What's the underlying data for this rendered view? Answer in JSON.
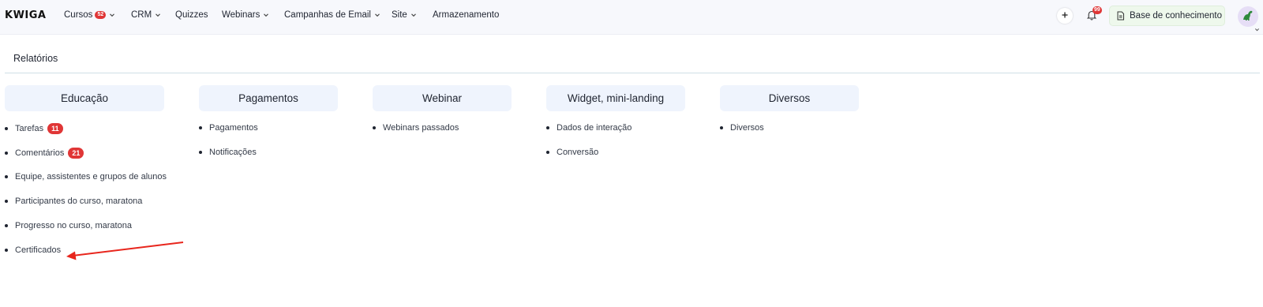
{
  "app": {
    "logo": "KWIGA"
  },
  "nav": {
    "items": [
      {
        "label": "Cursos",
        "badge": "52",
        "dropdown": true
      },
      {
        "label": "CRM",
        "dropdown": true
      },
      {
        "label": "Quizzes",
        "dropdown": false
      },
      {
        "label": "Webinars",
        "dropdown": true
      },
      {
        "label": "Campanhas de Email",
        "dropdown": true
      },
      {
        "label": "Site",
        "dropdown": true
      },
      {
        "label": "Armazenamento",
        "dropdown": false
      }
    ]
  },
  "header_actions": {
    "notifications_badge": "99",
    "knowledge_base_label": "Base de conhecimento"
  },
  "page": {
    "title": "Relatórios"
  },
  "columns": [
    {
      "header": "Educação",
      "items": [
        {
          "label": "Tarefas",
          "badge": "11"
        },
        {
          "label": "Comentários",
          "badge": "21"
        },
        {
          "label": "Equipe, assistentes e grupos de alunos"
        },
        {
          "label": "Participantes do curso, maratona"
        },
        {
          "label": "Progresso no curso, maratona"
        },
        {
          "label": "Certificados"
        }
      ]
    },
    {
      "header": "Pagamentos",
      "items": [
        {
          "label": "Pagamentos"
        },
        {
          "label": "Notificações"
        }
      ]
    },
    {
      "header": "Webinar",
      "items": [
        {
          "label": "Webinars passados"
        }
      ]
    },
    {
      "header": "Widget, mini-landing",
      "items": [
        {
          "label": "Dados de interação"
        },
        {
          "label": "Conversão"
        }
      ]
    },
    {
      "header": "Diversos",
      "items": [
        {
          "label": "Diversos"
        }
      ]
    }
  ],
  "colors": {
    "badge_red": "#e03636",
    "column_header_bg": "#eff4fd",
    "kb_button_bg": "#eef8ec",
    "annotation_arrow": "#e8261d"
  }
}
